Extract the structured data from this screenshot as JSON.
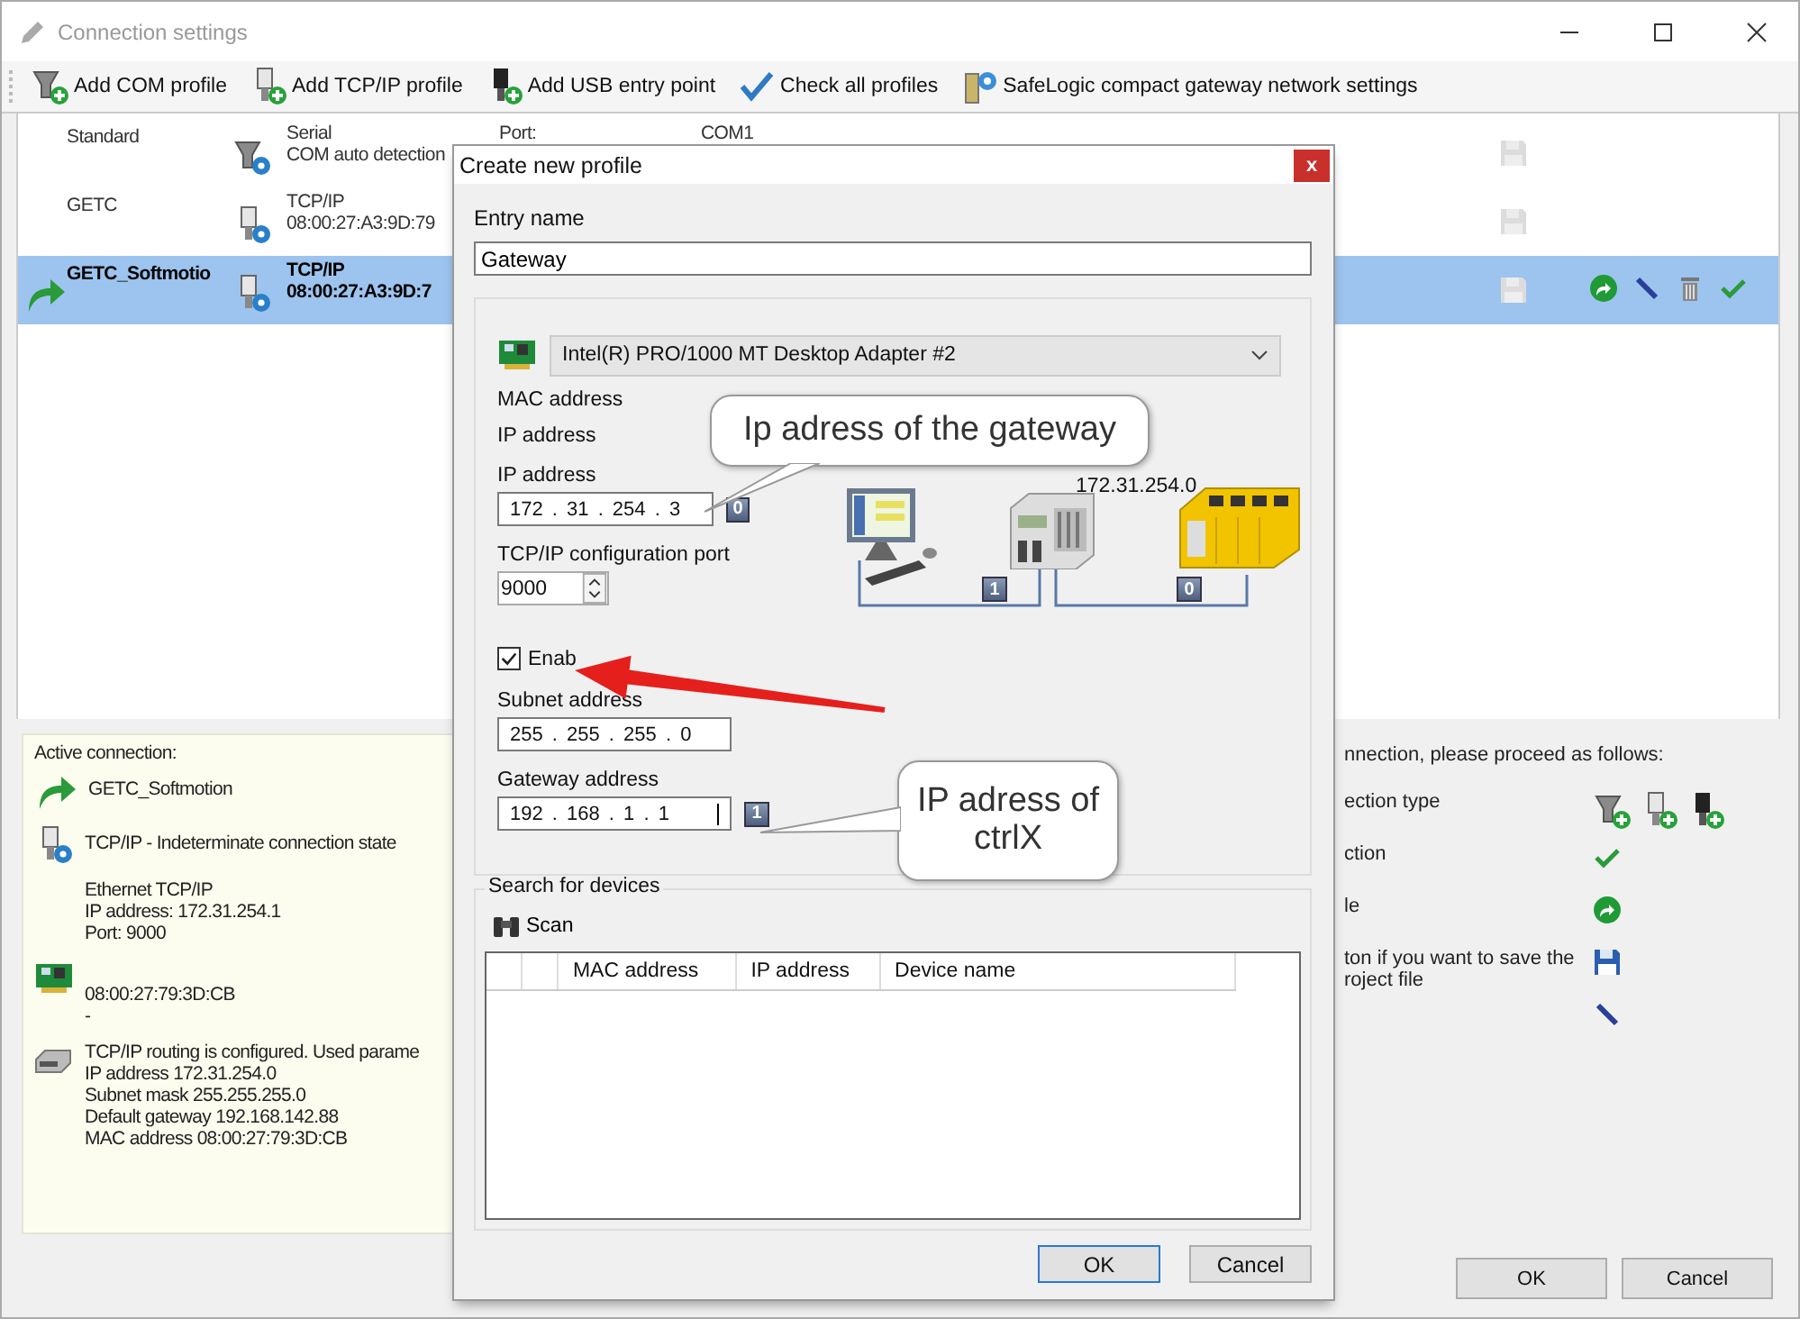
{
  "window": {
    "title": "Connection settings"
  },
  "toolbar": [
    {
      "label": "Add COM profile",
      "kind": "com"
    },
    {
      "label": "Add TCP/IP profile",
      "kind": "tcp"
    },
    {
      "label": "Add USB entry point",
      "kind": "usb"
    },
    {
      "label": "Check all profiles",
      "kind": "check"
    },
    {
      "label": "SafeLogic compact gateway network settings",
      "kind": "gateway"
    }
  ],
  "profiles": [
    {
      "name": "Standard",
      "kind": "com",
      "type": "Serial",
      "detail": "COM auto detection",
      "port_label": "Port:",
      "port_value": "COM1",
      "selected": false,
      "active": false
    },
    {
      "name": "GETC",
      "kind": "tcp",
      "type": "TCP/IP",
      "detail": "08:00:27:A3:9D:79",
      "selected": false,
      "active": false
    },
    {
      "name": "GETC_Softmotio",
      "kind": "tcp",
      "type": "TCP/IP",
      "detail": "08:00:27:A3:9D:7",
      "selected": true,
      "active": true
    }
  ],
  "active_connection": {
    "heading": "Active connection:",
    "name": "GETC_Softmotion",
    "state": "TCP/IP - Indeterminate connection state",
    "details": [
      "Ethernet TCP/IP",
      "IP address: 172.31.254.1",
      "Port: 9000"
    ],
    "adapter": [
      "08:00:27:79:3D:CB",
      "-"
    ],
    "routing": [
      "TCP/IP routing is configured. Used parame",
      "IP address 172.31.254.0",
      "Subnet mask 255.255.255.0",
      "Default gateway 192.168.142.88",
      "MAC address 08:00:27:79:3D:CB"
    ]
  },
  "instructions": {
    "heading": "nnection, please proceed as follows:",
    "steps": [
      {
        "kind": "add",
        "lines": [
          "ection type"
        ]
      },
      {
        "kind": "check",
        "lines": [
          "ction"
        ]
      },
      {
        "kind": "activate",
        "lines": [
          "le"
        ]
      },
      {
        "kind": "save",
        "lines": [
          "ton if you want to save the",
          "roject file"
        ]
      },
      {
        "kind": "edit"
      }
    ]
  },
  "buttons": [
    {
      "label": "OK"
    },
    {
      "label": "Cancel"
    }
  ],
  "dialog": {
    "title": "Create new profile",
    "close": "x",
    "entry_label": "Entry name",
    "entry_value": "Gateway",
    "adapter": "Intel(R) PRO/1000 MT Desktop Adapter #2",
    "mac_label": "MAC address",
    "ip_info_label": "IP address",
    "ip_label": "IP address",
    "ip": "172 . 31 . 254 . 3",
    "ip_port": "0",
    "port_label": "TCP/IP configuration port",
    "port_value": "9000",
    "diagram": {
      "network": "172.31.254.0",
      "pc_port": "1",
      "module_port": "0"
    },
    "routing": {
      "label": "Enab",
      "checked": true
    },
    "subnet_label": "Subnet address",
    "subnet": "255 . 255 . 255 . 0",
    "gateway_label": "Gateway address",
    "gateway": "192 . 168 . 1 . 1",
    "gateway_port": "1",
    "search": {
      "title": "Search for devices",
      "scan": "Scan",
      "columns": [
        "MAC address",
        "IP address",
        "Device name"
      ]
    },
    "buttons": [
      {
        "label": "OK",
        "default": true
      },
      {
        "label": "Cancel",
        "default": false
      }
    ]
  },
  "callouts": [
    {
      "lines": [
        "Ip adress of the gateway"
      ]
    },
    {
      "lines": [
        "IP adress of",
        "ctrlX"
      ]
    }
  ]
}
